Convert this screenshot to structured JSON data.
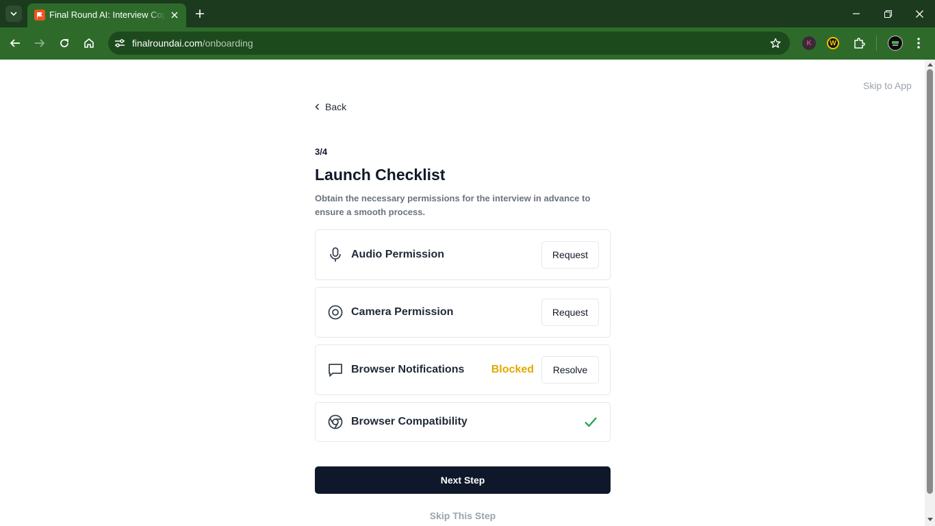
{
  "browser": {
    "tab_title": "Final Round AI: Interview Copilot",
    "url_domain": "finalroundai.com",
    "url_path": "/onboarding",
    "extensions": [
      "K",
      "W"
    ],
    "colors": {
      "tabbar": "#1b3a1e",
      "toolbar": "#2e6b2b"
    }
  },
  "page": {
    "skip_to_app": "Skip to App",
    "back_label": "Back",
    "step_counter": "3/4",
    "title": "Launch Checklist",
    "description": "Obtain the necessary permissions for the interview in advance to ensure a smooth process.",
    "checklist": [
      {
        "label": "Audio Permission",
        "icon": "microphone-icon",
        "action": "Request"
      },
      {
        "label": "Camera Permission",
        "icon": "camera-icon",
        "action": "Request"
      },
      {
        "label": "Browser Notifications",
        "icon": "notification-icon",
        "status": "Blocked",
        "action": "Resolve"
      },
      {
        "label": "Browser Compatibility",
        "icon": "chrome-icon",
        "status_icon": "check-icon"
      }
    ],
    "next_button": "Next Step",
    "skip_step": "Skip This Step",
    "colors": {
      "primary_button": "#0f172a",
      "blocked": "#e0a800",
      "success": "#16a34a"
    }
  }
}
